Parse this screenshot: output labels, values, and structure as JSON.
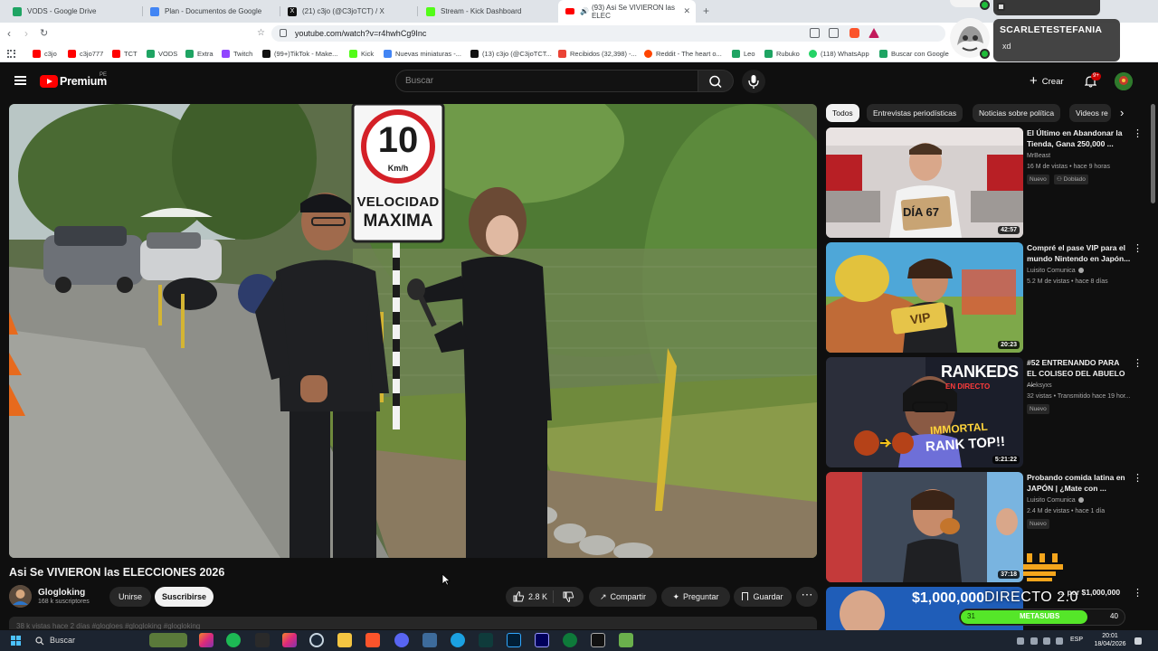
{
  "browser": {
    "tabs": [
      {
        "title": "VODS - Google Drive",
        "color": "#1fa463"
      },
      {
        "title": "Plan - Documentos de Google",
        "color": "#4285f4"
      },
      {
        "title": "(21) c3jo (@C3joTCT) / X",
        "color": "#111111"
      },
      {
        "title": "Stream - Kick Dashboard",
        "color": "#53fc18"
      },
      {
        "title": "(93) Asi Se VIVIERON las ELEC",
        "color": "#ff0000",
        "active": true
      }
    ],
    "url": "youtube.com/watch?v=r4hwhCg9Inc",
    "bookmarks": [
      {
        "label": "c3jo",
        "color": "#ff0000"
      },
      {
        "label": "c3jo777",
        "color": "#ff0000"
      },
      {
        "label": "TCT",
        "color": "#ff0000"
      },
      {
        "label": "VODS",
        "color": "#1fa463"
      },
      {
        "label": "Extra",
        "color": "#1fa463"
      },
      {
        "label": "Twitch",
        "color": "#9146ff"
      },
      {
        "label": "(99+)TikTok - Make...",
        "color": "#111111"
      },
      {
        "label": "Kick",
        "color": "#53fc18"
      },
      {
        "label": "Nuevas miniaturas -...",
        "color": "#4285f4"
      },
      {
        "label": "(13) c3jo (@C3joTCT...",
        "color": "#111111"
      },
      {
        "label": "Recibidos (32,398) -...",
        "color": "#ea4335"
      },
      {
        "label": "Reddit - The heart o...",
        "color": "#ff4500"
      },
      {
        "label": "Leo",
        "color": "#1fa463"
      },
      {
        "label": "Rubuko",
        "color": "#1fa463"
      },
      {
        "label": "(118) WhatsApp",
        "color": "#25d366"
      },
      {
        "label": "Buscar con Google",
        "color": "#1fa463"
      }
    ]
  },
  "chat": {
    "username": "SCARLETESTEFANIA",
    "message": "xd"
  },
  "youtube": {
    "brand": "Premium",
    "region": "PE",
    "search_placeholder": "Buscar",
    "create_label": "Crear",
    "notif_count": "9+",
    "video": {
      "title": "Asi Se VIVIERON las ELECCIONES 2026",
      "sign_number": "10",
      "sign_unit": "Km/h",
      "sign_line1": "VELOCIDAD",
      "sign_line2": "MAXIMA"
    },
    "channel": {
      "name": "Glogloking",
      "subs": "168 k suscriptores"
    },
    "actions": {
      "join": "Unirse",
      "subscribe": "Suscribirse",
      "likes": "2.8 K",
      "share": "Compartir",
      "ask": "Preguntar",
      "save": "Guardar"
    },
    "description_peek": "38 k vistas  hace 2 días  #glogloes #glogloking #glogloking",
    "chips": [
      "Todos",
      "Entrevistas periodísticas",
      "Noticias sobre política",
      "Videos re"
    ],
    "recommendations": [
      {
        "title": "El Último en Abandonar la Tienda, Gana 250,000 ...",
        "channel": "MrBeast",
        "meta": "16 M de vistas • hace 9 horas",
        "badges": [
          "Nuevo",
          "Doblado"
        ],
        "duration": "42:57",
        "thumb_text": "DÍA 67"
      },
      {
        "title": "Compré el pase VIP para el mundo Nintendo en Japón...",
        "channel": "Luisito Comunica",
        "meta": "5.2 M de vistas • hace 8 días",
        "badges": [],
        "duration": "20:23",
        "thumb_text": "VIP"
      },
      {
        "title": "#52 ENTRENANDO PARA EL COLISEO DEL ABUELO ...",
        "channel": "Aleksyxs",
        "meta": "32 vistas • Transmitido hace 19 hor...",
        "badges": [
          "Nuevo"
        ],
        "duration": "5:21:22",
        "thumb_text": "RANKEDS"
      },
      {
        "title": "Probando comida latina en JAPÓN | ¿Mate con ...",
        "channel": "Luisito Comunica",
        "meta": "2.4 M de vistas • hace 1 día",
        "badges": [
          "Nuevo"
        ],
        "duration": "37:18",
        "thumb_text": ""
      },
      {
        "title": "... por $1,000,000",
        "channel": "",
        "meta": "",
        "badges": [],
        "duration": "",
        "thumb_text": "$1,000,000"
      }
    ]
  },
  "overlay": {
    "directo": "DIRECTO 2.0",
    "meta_left": "31",
    "meta_label": "METASUBS",
    "meta_right": "40",
    "meta_progress": 0.775
  },
  "taskbar": {
    "search": "Buscar",
    "lang": "ESP",
    "time": "20:01",
    "date": "18/04/2026"
  }
}
